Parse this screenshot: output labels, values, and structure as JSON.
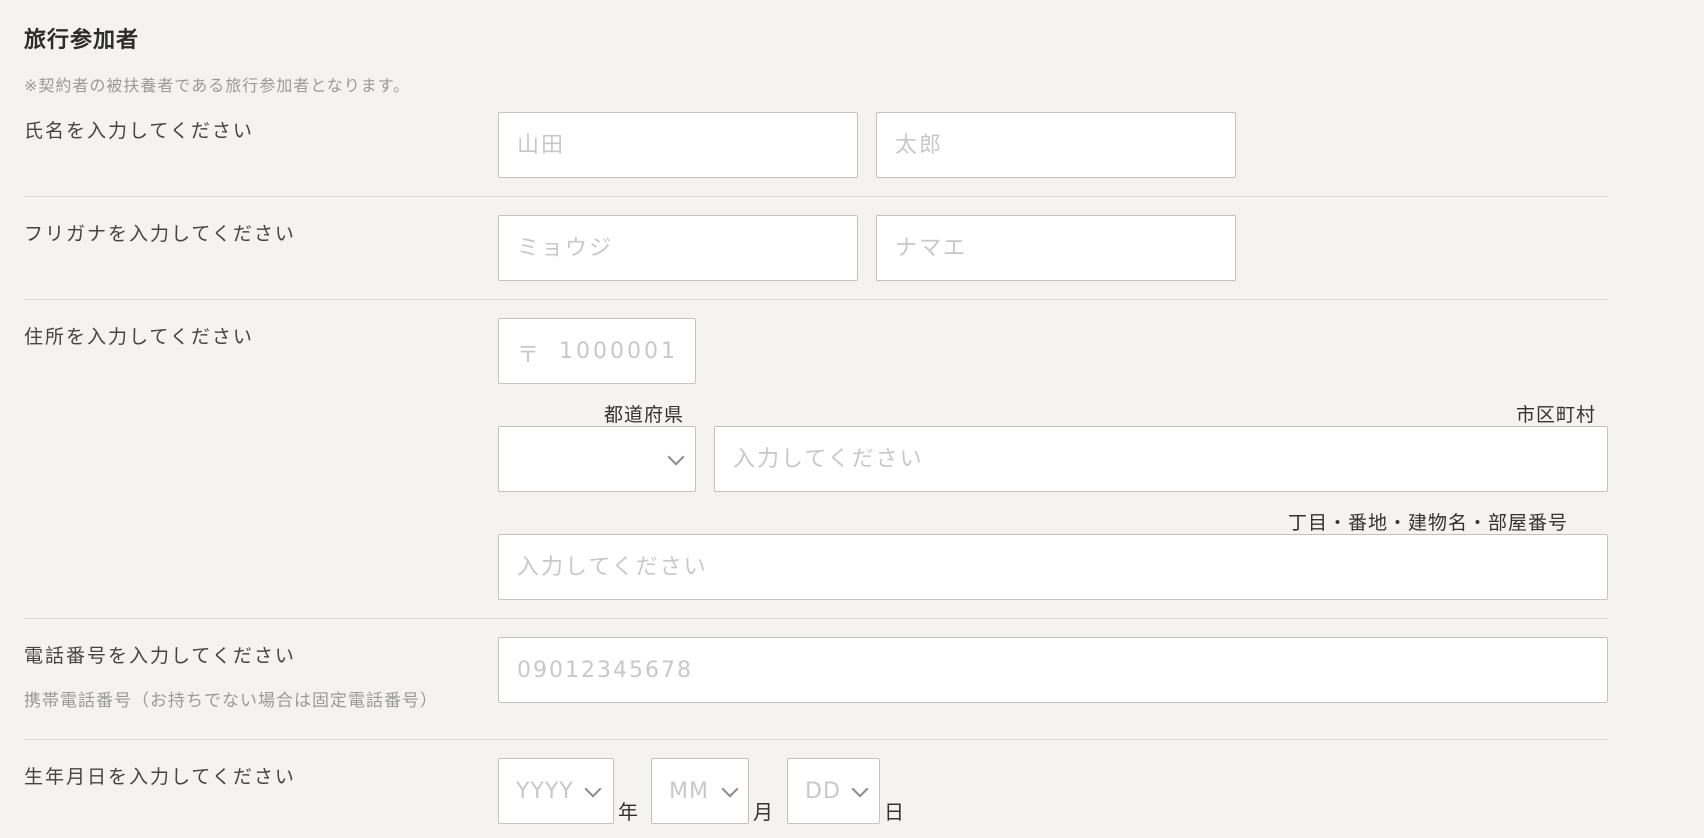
{
  "section": {
    "title": "旅行参加者",
    "note": "※契約者の被扶養者である旅行参加者となります。"
  },
  "name_row": {
    "label": "氏名を入力してください",
    "last_placeholder": "山田",
    "first_placeholder": "太郎"
  },
  "kana_row": {
    "label": "フリガナを入力してください",
    "last_placeholder": "ミョウジ",
    "first_placeholder": "ナマエ"
  },
  "address_row": {
    "label": "住所を入力してください",
    "zip_mark": "〒",
    "zip_placeholder": "1000001",
    "prefecture_label": "都道府県",
    "prefecture_value": "",
    "city_label": "市区町村",
    "city_placeholder": "入力してください",
    "street_label": "丁目・番地・建物名・部屋番号",
    "street_placeholder": "入力してください"
  },
  "phone_row": {
    "label": "電話番号を入力してください",
    "sub": "携帯電話番号（お持ちでない場合は固定電話番号）",
    "placeholder": "09012345678"
  },
  "birth_row": {
    "label": "生年月日を入力してください",
    "year_placeholder": "YYYY",
    "year_unit": "年",
    "month_placeholder": "MM",
    "month_unit": "月",
    "day_placeholder": "DD",
    "day_unit": "日"
  },
  "icons": {
    "select_arrow": "chevron-down-icon"
  }
}
